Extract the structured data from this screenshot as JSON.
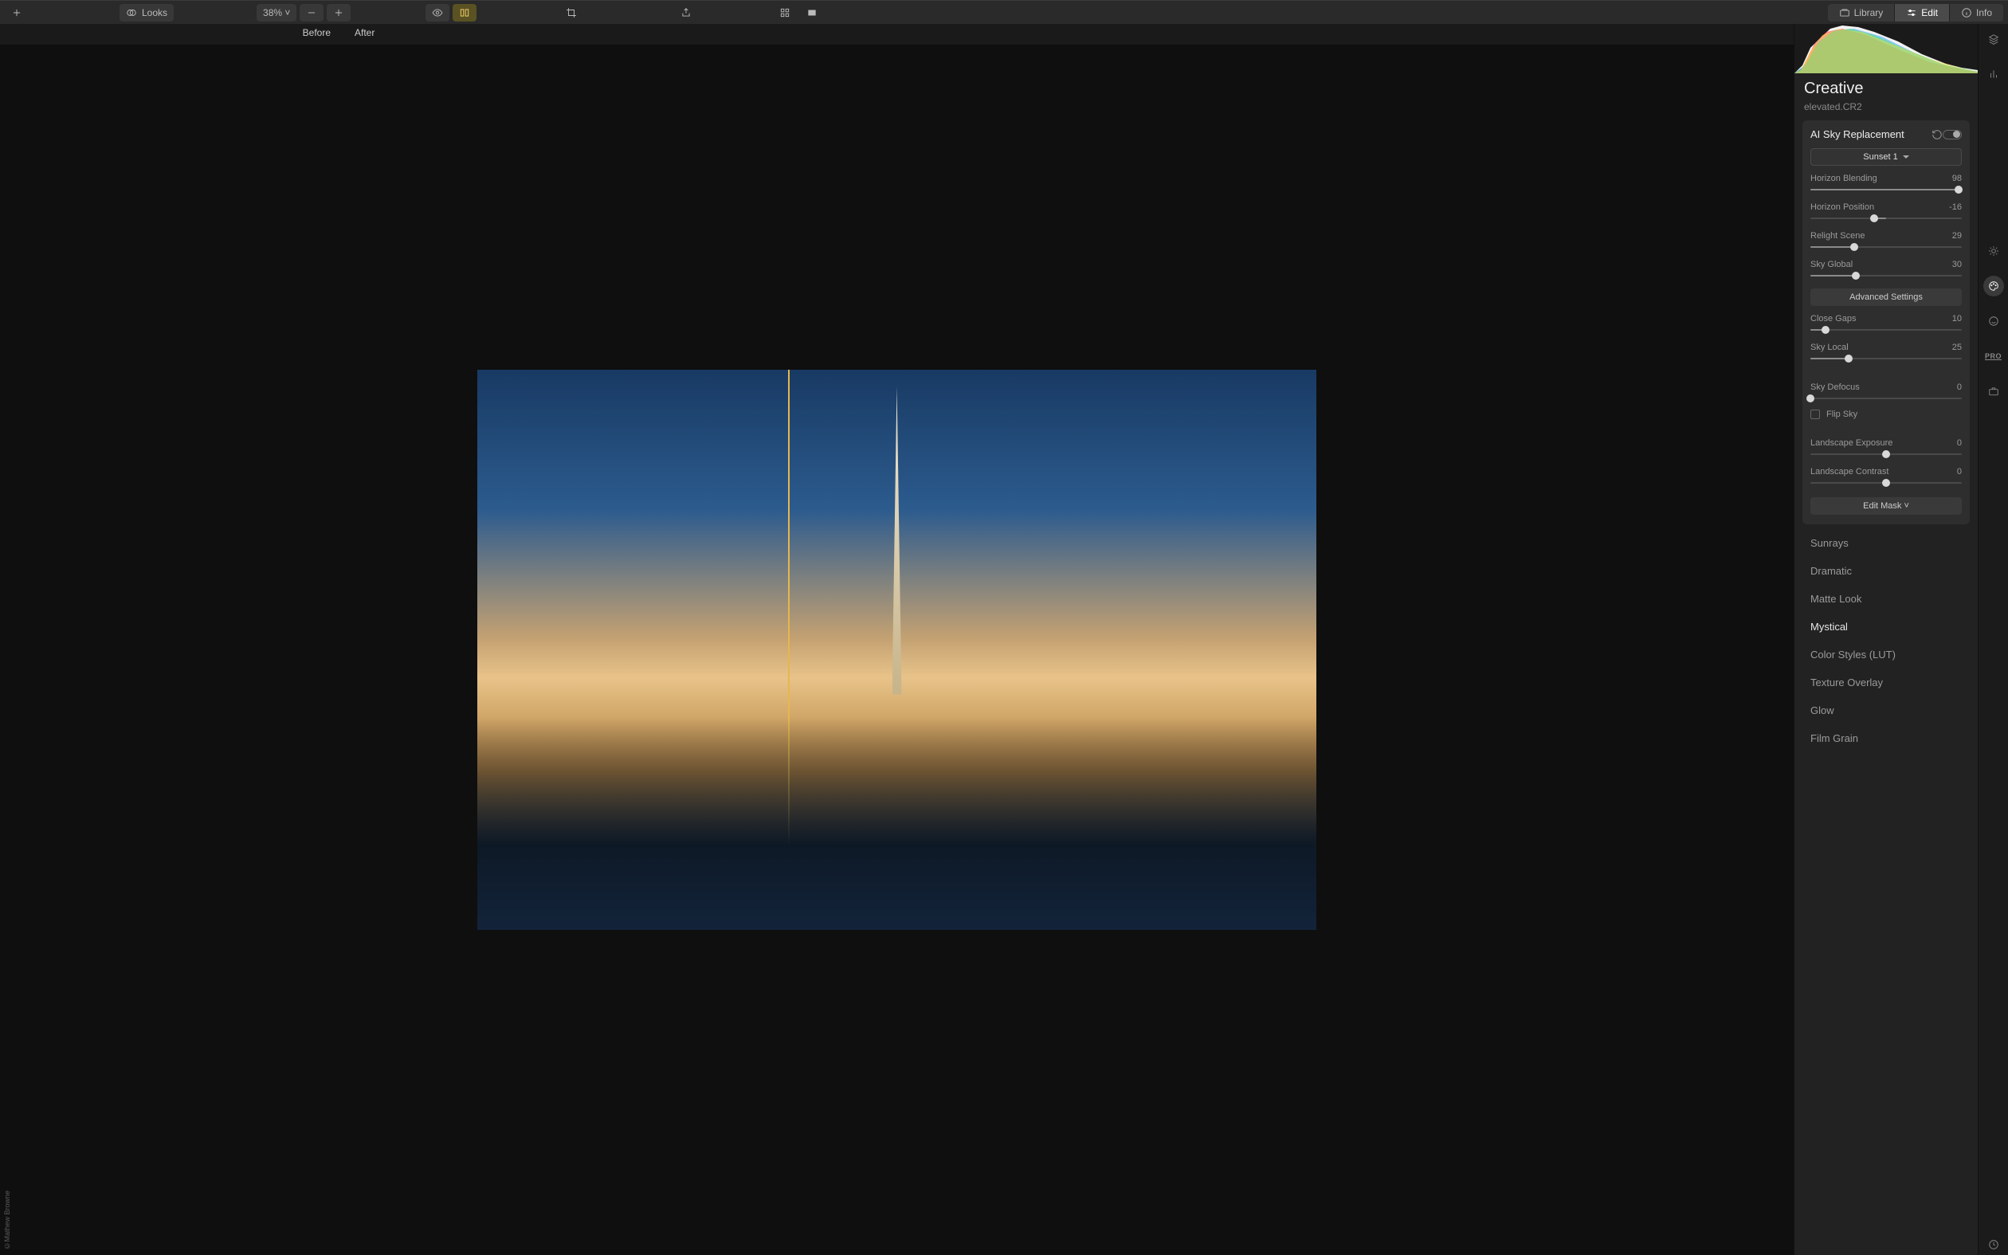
{
  "toolbar": {
    "looks_label": "Looks",
    "zoom_label": "38%",
    "tabs": {
      "library": "Library",
      "edit": "Edit",
      "info": "Info"
    }
  },
  "compare": {
    "before": "Before",
    "after": "After"
  },
  "watermark": "©Mathew Browne",
  "panel": {
    "title": "Creative",
    "filename": "elevated.CR2",
    "tool": {
      "name": "AI Sky Replacement",
      "preset": "Sunset 1",
      "sliders": [
        {
          "label": "Horizon Blending",
          "value": 98,
          "min": 0,
          "max": 100
        },
        {
          "label": "Horizon Position",
          "value": -16,
          "min": -100,
          "max": 100
        },
        {
          "label": "Relight Scene",
          "value": 29,
          "min": 0,
          "max": 100
        },
        {
          "label": "Sky Global",
          "value": 30,
          "min": 0,
          "max": 100
        }
      ],
      "advanced_label": "Advanced Settings",
      "adv_sliders": [
        {
          "label": "Close Gaps",
          "value": 10,
          "min": 0,
          "max": 100
        },
        {
          "label": "Sky Local",
          "value": 25,
          "min": 0,
          "max": 100
        }
      ],
      "extra_sliders": [
        {
          "label": "Sky Defocus",
          "value": 0,
          "min": 0,
          "max": 100
        }
      ],
      "flip_label": "Flip Sky",
      "landscape_sliders": [
        {
          "label": "Landscape Exposure",
          "value": 0,
          "min": -100,
          "max": 100
        },
        {
          "label": "Landscape Contrast",
          "value": 0,
          "min": -100,
          "max": 100
        }
      ],
      "edit_mask_label": "Edit Mask"
    },
    "filters": [
      {
        "label": "Sunrays",
        "bright": false
      },
      {
        "label": "Dramatic",
        "bright": false
      },
      {
        "label": "Matte Look",
        "bright": false
      },
      {
        "label": "Mystical",
        "bright": true
      },
      {
        "label": "Color Styles (LUT)",
        "bright": false
      },
      {
        "label": "Texture Overlay",
        "bright": false
      },
      {
        "label": "Glow",
        "bright": false
      },
      {
        "label": "Film Grain",
        "bright": false
      }
    ]
  },
  "rail": {
    "pro_label": "PRO"
  }
}
